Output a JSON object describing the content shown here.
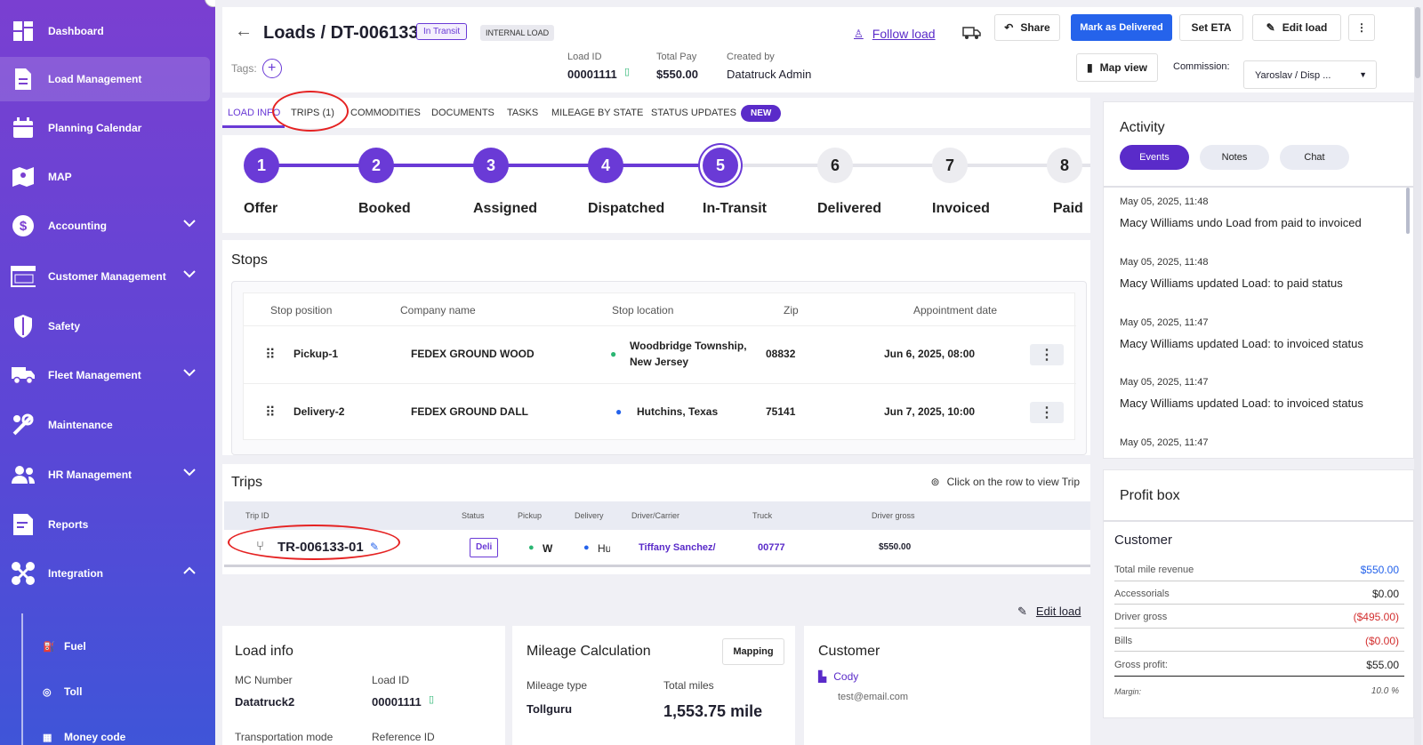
{
  "sidebar": {
    "items": [
      {
        "label": "Dashboard",
        "icon": "dashboard-icon"
      },
      {
        "label": "Load Management",
        "icon": "document-icon"
      },
      {
        "label": "Planning Calendar",
        "icon": "calendar-icon"
      },
      {
        "label": "MAP",
        "icon": "map-icon"
      },
      {
        "label": "Accounting",
        "icon": "dollar-icon"
      },
      {
        "label": "Customer Management",
        "icon": "crm-icon"
      },
      {
        "label": "Safety",
        "icon": "shield-icon"
      },
      {
        "label": "Fleet Management",
        "icon": "truck-icon"
      },
      {
        "label": "Maintenance",
        "icon": "wrench-icon"
      },
      {
        "label": "HR Management",
        "icon": "users-icon"
      },
      {
        "label": "Reports",
        "icon": "report-icon"
      },
      {
        "label": "Integration",
        "icon": "integration-icon"
      }
    ],
    "sub_items": [
      {
        "label": "Fuel",
        "icon": "fuel-icon"
      },
      {
        "label": "Toll",
        "icon": "toll-icon"
      },
      {
        "label": "Money code",
        "icon": "money-code-icon"
      }
    ]
  },
  "header": {
    "title": "Loads / DT-006133",
    "status_badge": "In Transit",
    "type_badge": "INTERNAL LOAD",
    "follow_label": "Follow load",
    "share_label": "Share",
    "mark_delivered_label": "Mark as Delivered",
    "set_eta_label": "Set ETA",
    "edit_load_label": "Edit load",
    "tags_label": "Tags:",
    "load_id_label": "Load ID",
    "load_id_value": "00001111",
    "total_pay_label": "Total Pay",
    "total_pay_value": "$550.00",
    "created_by_label": "Created by",
    "created_by_value": "Datatruck Admin",
    "map_view_label": "Map view",
    "commission_label": "Commission:",
    "commission_value": "Yaroslav / Disp ..."
  },
  "tabs": [
    {
      "label": "LOAD INFO"
    },
    {
      "label": "TRIPS (1)"
    },
    {
      "label": "COMMODITIES"
    },
    {
      "label": "DOCUMENTS"
    },
    {
      "label": "TASKS"
    },
    {
      "label": "MILEAGE BY STATE"
    },
    {
      "label": "STATUS UPDATES"
    }
  ],
  "new_badge": "NEW",
  "steps": [
    {
      "num": "1",
      "label": "Offer"
    },
    {
      "num": "2",
      "label": "Booked"
    },
    {
      "num": "3",
      "label": "Assigned"
    },
    {
      "num": "4",
      "label": "Dispatched"
    },
    {
      "num": "5",
      "label": "In-Transit"
    },
    {
      "num": "6",
      "label": "Delivered"
    },
    {
      "num": "7",
      "label": "Invoiced"
    },
    {
      "num": "8",
      "label": "Paid"
    }
  ],
  "stops": {
    "title": "Stops",
    "columns": [
      "Stop position",
      "Company name",
      "Stop location",
      "Zip",
      "Appointment date"
    ],
    "rows": [
      {
        "position": "Pickup-1",
        "company": "FEDEX GROUND WOOD",
        "location_l1": "Woodbridge Township,",
        "location_l2": "New Jersey",
        "zip": "08832",
        "date": "Jun 6, 2025, 08:00"
      },
      {
        "position": "Delivery-2",
        "company": "FEDEX GROUND DALL",
        "location_l1": "Hutchins, Texas",
        "location_l2": "",
        "zip": "75141",
        "date": "Jun 7, 2025, 10:00"
      }
    ]
  },
  "trips": {
    "title": "Trips",
    "hint": "Click on the row to view Trip",
    "columns": [
      "Trip ID",
      "Status",
      "Pickup",
      "Delivery",
      "Driver/Carrier",
      "Truck",
      "Driver gross"
    ],
    "row": {
      "trip_id": "TR-006133-01",
      "status": "Deli",
      "pickup": "W",
      "delivery": "Hu",
      "driver": "Tiffany Sanchez/",
      "truck": "00777",
      "gross": "$550.00"
    }
  },
  "edit_load_link": "Edit load",
  "load_info": {
    "title": "Load info",
    "mc_label": "MC Number",
    "mc_value": "Datatruck2",
    "load_id_label": "Load ID",
    "load_id_value": "00001111",
    "transport_label": "Transportation mode",
    "reference_label": "Reference ID"
  },
  "mileage": {
    "title": "Mileage Calculation",
    "mapping_label": "Mapping",
    "type_label": "Mileage type",
    "type_value": "Tollguru",
    "total_label": "Total miles",
    "total_value": "1,553.75 mile"
  },
  "customer": {
    "title": "Customer",
    "name": "Cody",
    "email": "test@email.com"
  },
  "activity": {
    "title": "Activity",
    "tabs": [
      "Events",
      "Notes",
      "Chat"
    ],
    "events": [
      {
        "time": "May 05, 2025, 11:48",
        "text": "Macy Williams undo Load from paid to invoiced"
      },
      {
        "time": "May 05, 2025, 11:48",
        "text": "Macy Williams updated Load: to paid status"
      },
      {
        "time": "May 05, 2025, 11:47",
        "text": "Macy Williams updated Load: to invoiced status"
      },
      {
        "time": "May 05, 2025, 11:47",
        "text": "Macy Williams updated Load: to invoiced status"
      },
      {
        "time": "May 05, 2025, 11:47",
        "text": ""
      }
    ]
  },
  "profit": {
    "title": "Profit box",
    "subtitle": "Customer",
    "rows": [
      {
        "label": "Total mile revenue",
        "value": "$550.00",
        "color": "#2563eb"
      },
      {
        "label": "Accessorials",
        "value": "$0.00",
        "color": "#222222"
      },
      {
        "label": "Driver gross",
        "value": "($495.00)",
        "color": "#d32f2f"
      },
      {
        "label": "Bills",
        "value": "($0.00)",
        "color": "#d32f2f"
      },
      {
        "label": "Gross profit:",
        "value": "$55.00",
        "color": "#222222"
      },
      {
        "label": "Margin:",
        "value": "10.0 %",
        "color": "#555555"
      }
    ]
  },
  "colors": {
    "accent": "#6a3ad6",
    "primary": "#2563eb",
    "sidebar_top": "#7a3fd1",
    "sidebar_bottom": "#3f55d8"
  }
}
